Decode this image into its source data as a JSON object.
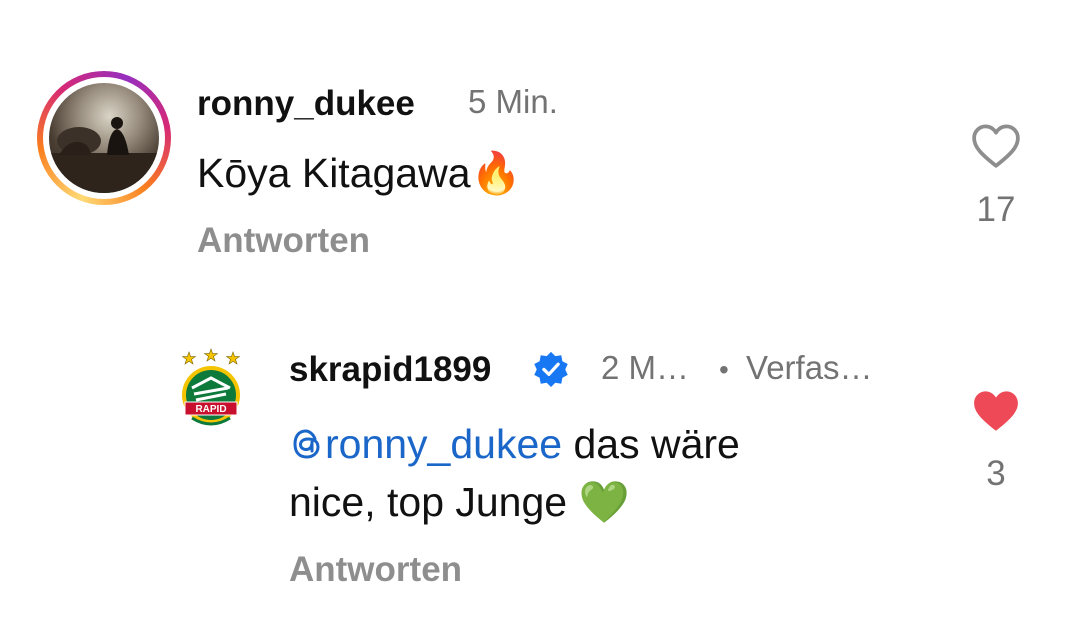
{
  "comments": [
    {
      "username": "ronny_dukee",
      "time": "5 Min.",
      "text": "Kōya Kitagawa",
      "emoji": "🔥",
      "reply_label": "Antworten",
      "likes": "17",
      "liked": false,
      "avatar_icon": "profile-photo",
      "has_story_ring": true
    },
    {
      "username": "skrapid1899",
      "verified": true,
      "time": "2 M…",
      "author_label": "Verfas…",
      "mention": "ronny_dukee",
      "text_line1": " das wäre",
      "text_line2": "nice, top Junge ",
      "emoji": "💚",
      "reply_label": "Antworten",
      "likes": "3",
      "liked": true,
      "avatar_icon": "rapid-crest"
    }
  ],
  "colors": {
    "liked_heart": "#ed4956",
    "mention": "#1a66c9",
    "verified_badge": "#1877f2",
    "secondary_text": "#737373"
  }
}
